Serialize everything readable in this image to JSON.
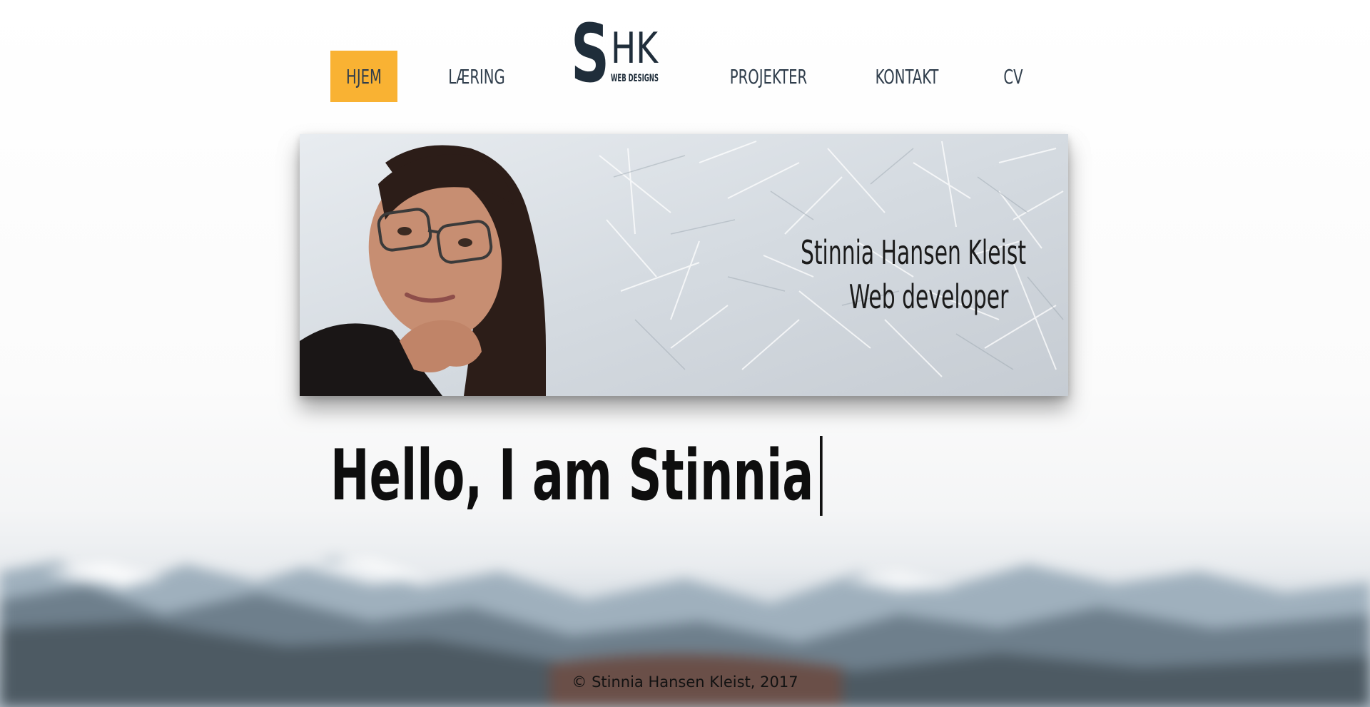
{
  "nav": {
    "items": [
      {
        "label": "HJEM",
        "active": true
      },
      {
        "label": "LÆRING",
        "active": false
      },
      {
        "label": "PROJEKTER",
        "active": false
      },
      {
        "label": "KONTAKT",
        "active": false
      },
      {
        "label": "CV",
        "active": false
      }
    ]
  },
  "logo": {
    "letter_s": "S",
    "letters_hk": "HK",
    "subtitle": "WEB DESIGNS"
  },
  "banner": {
    "name": "Stinnia Hansen Kleist",
    "role": "Web developer"
  },
  "hero": {
    "heading": "Hello, I am Stinnia"
  },
  "footer": {
    "copyright": "© Stinnia Hansen Kleist, 2017"
  },
  "colors": {
    "accent": "#f9b233",
    "nav_text": "#2f3d4b",
    "logo": "#1f2d3a"
  }
}
